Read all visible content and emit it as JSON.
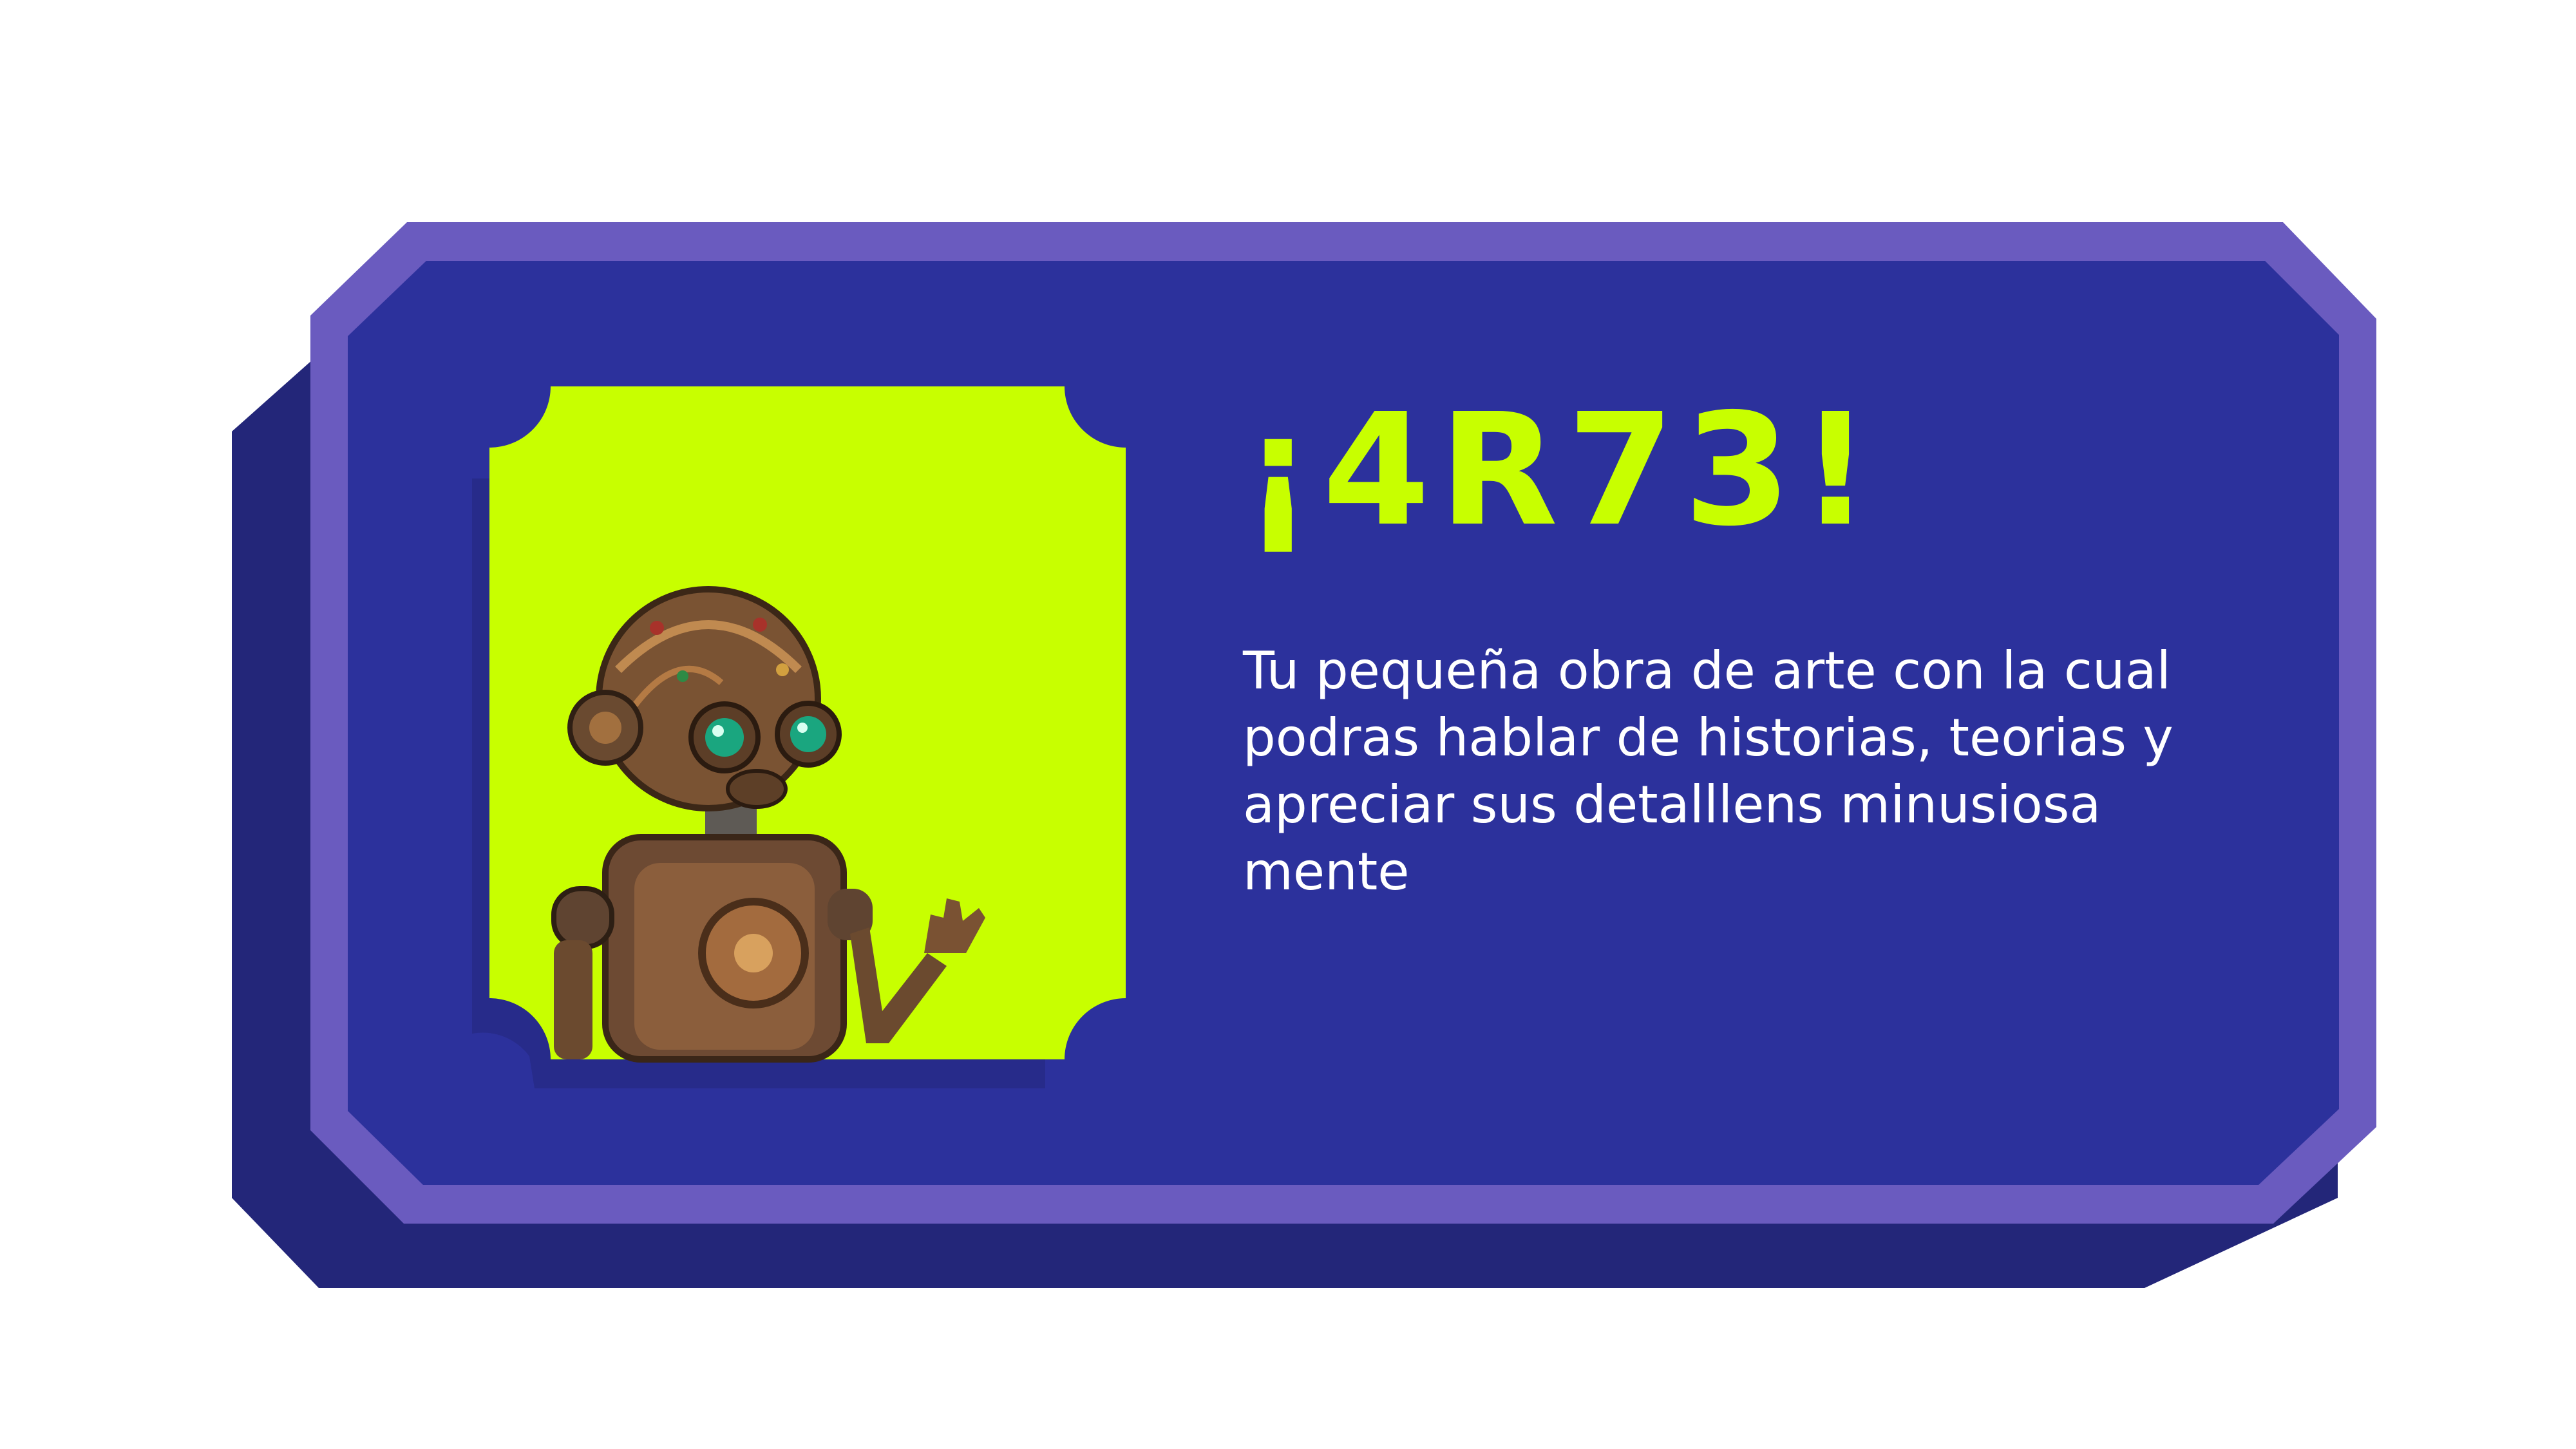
{
  "colors": {
    "background": "#ffffff",
    "card_shadow": "#232679",
    "card_border": "#6a5bbf",
    "card_fill": "#2c319c",
    "frame_fill": "#c8ff00",
    "frame_shadow": "#272b8a",
    "title_color": "#c8ff00",
    "text_color": "#ffffff"
  },
  "card": {
    "title": "¡4R73!",
    "description": "Tu pequeña obra de arte con la cual podras hablar de historias, teorias y apreciar sus detalllens minusiosa mente"
  },
  "illustration": {
    "subject": "steampunk-robot-figure"
  }
}
